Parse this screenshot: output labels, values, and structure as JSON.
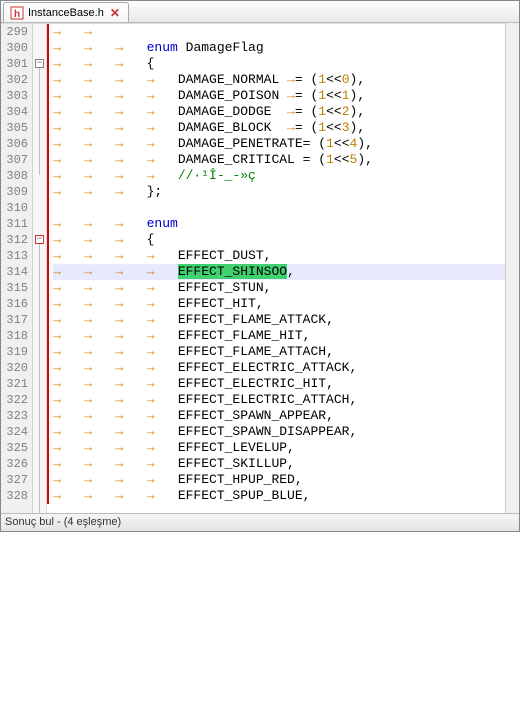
{
  "tab": {
    "filename": "InstanceBase.h"
  },
  "status_text": "Sonuç bul - (4 eşleşme)",
  "first_line_no": 299,
  "fold_boxes": [
    {
      "line": 301,
      "sym": "−"
    },
    {
      "line": 312,
      "sym": "−",
      "red": true
    }
  ],
  "highlighted_line": 314,
  "lines": [
    {
      "n": 299,
      "seg": [
        {
          "t": "→   →   ",
          "c": "arr"
        }
      ]
    },
    {
      "n": 300,
      "seg": [
        {
          "t": "→   →   →   ",
          "c": "arr"
        },
        {
          "t": "enum",
          "c": "kw"
        },
        {
          "t": " DamageFlag"
        }
      ]
    },
    {
      "n": 301,
      "seg": [
        {
          "t": "→   →   →   ",
          "c": "arr"
        },
        {
          "t": "{",
          "c": "op"
        }
      ]
    },
    {
      "n": 302,
      "seg": [
        {
          "t": "→   →   →   →   ",
          "c": "arr"
        },
        {
          "t": "DAMAGE_NORMAL "
        },
        {
          "t": "→",
          "c": "arr"
        },
        {
          "t": "= ",
          "c": "op"
        },
        {
          "t": "(",
          "c": "op"
        },
        {
          "t": "1",
          "c": "num"
        },
        {
          "t": "<<",
          "c": "op"
        },
        {
          "t": "0",
          "c": "num"
        },
        {
          "t": "),",
          "c": "op"
        }
      ]
    },
    {
      "n": 303,
      "seg": [
        {
          "t": "→   →   →   →   ",
          "c": "arr"
        },
        {
          "t": "DAMAGE_POISON "
        },
        {
          "t": "→",
          "c": "arr"
        },
        {
          "t": "= ",
          "c": "op"
        },
        {
          "t": "(",
          "c": "op"
        },
        {
          "t": "1",
          "c": "num"
        },
        {
          "t": "<<",
          "c": "op"
        },
        {
          "t": "1",
          "c": "num"
        },
        {
          "t": "),",
          "c": "op"
        }
      ]
    },
    {
      "n": 304,
      "seg": [
        {
          "t": "→   →   →   →   ",
          "c": "arr"
        },
        {
          "t": "DAMAGE_DODGE  "
        },
        {
          "t": "→",
          "c": "arr"
        },
        {
          "t": "= ",
          "c": "op"
        },
        {
          "t": "(",
          "c": "op"
        },
        {
          "t": "1",
          "c": "num"
        },
        {
          "t": "<<",
          "c": "op"
        },
        {
          "t": "2",
          "c": "num"
        },
        {
          "t": "),",
          "c": "op"
        }
      ]
    },
    {
      "n": 305,
      "seg": [
        {
          "t": "→   →   →   →   ",
          "c": "arr"
        },
        {
          "t": "DAMAGE_BLOCK  "
        },
        {
          "t": "→",
          "c": "arr"
        },
        {
          "t": "= ",
          "c": "op"
        },
        {
          "t": "(",
          "c": "op"
        },
        {
          "t": "1",
          "c": "num"
        },
        {
          "t": "<<",
          "c": "op"
        },
        {
          "t": "3",
          "c": "num"
        },
        {
          "t": "),",
          "c": "op"
        }
      ]
    },
    {
      "n": 306,
      "seg": [
        {
          "t": "→   →   →   →   ",
          "c": "arr"
        },
        {
          "t": "DAMAGE_PENETRATE"
        },
        {
          "t": "= ",
          "c": "op"
        },
        {
          "t": "(",
          "c": "op"
        },
        {
          "t": "1",
          "c": "num"
        },
        {
          "t": "<<",
          "c": "op"
        },
        {
          "t": "4",
          "c": "num"
        },
        {
          "t": "),",
          "c": "op"
        }
      ]
    },
    {
      "n": 307,
      "seg": [
        {
          "t": "→   →   →   →   ",
          "c": "arr"
        },
        {
          "t": "DAMAGE_CRITICAL "
        },
        {
          "t": "= ",
          "c": "op"
        },
        {
          "t": "(",
          "c": "op"
        },
        {
          "t": "1",
          "c": "num"
        },
        {
          "t": "<<",
          "c": "op"
        },
        {
          "t": "5",
          "c": "num"
        },
        {
          "t": "),",
          "c": "op"
        }
      ]
    },
    {
      "n": 308,
      "seg": [
        {
          "t": "→   →   →   →   ",
          "c": "arr"
        },
        {
          "t": "//·¹Î-_-»ç",
          "c": "cm"
        }
      ]
    },
    {
      "n": 309,
      "seg": [
        {
          "t": "→   →   →   ",
          "c": "arr"
        },
        {
          "t": "};",
          "c": "op"
        }
      ]
    },
    {
      "n": 310,
      "seg": []
    },
    {
      "n": 311,
      "seg": [
        {
          "t": "→   →   →   ",
          "c": "arr"
        },
        {
          "t": "enum",
          "c": "kw"
        }
      ]
    },
    {
      "n": 312,
      "seg": [
        {
          "t": "→   →   →   ",
          "c": "arr"
        },
        {
          "t": "{",
          "c": "op"
        }
      ]
    },
    {
      "n": 313,
      "seg": [
        {
          "t": "→   →   →   →   ",
          "c": "arr"
        },
        {
          "t": "EFFECT_DUST"
        },
        {
          "t": ",",
          "c": "op"
        }
      ]
    },
    {
      "n": 314,
      "seg": [
        {
          "t": "→   →   →   →   ",
          "c": "arr"
        },
        {
          "t": "EFFECT_SHINSOO",
          "c": "selbg"
        },
        {
          "t": ",",
          "c": "op"
        }
      ]
    },
    {
      "n": 315,
      "seg": [
        {
          "t": "→   →   →   →   ",
          "c": "arr"
        },
        {
          "t": "EFFECT_STUN"
        },
        {
          "t": ",",
          "c": "op"
        }
      ]
    },
    {
      "n": 316,
      "seg": [
        {
          "t": "→   →   →   →   ",
          "c": "arr"
        },
        {
          "t": "EFFECT_HIT"
        },
        {
          "t": ",",
          "c": "op"
        }
      ]
    },
    {
      "n": 317,
      "seg": [
        {
          "t": "→   →   →   →   ",
          "c": "arr"
        },
        {
          "t": "EFFECT_FLAME_ATTACK"
        },
        {
          "t": ",",
          "c": "op"
        }
      ]
    },
    {
      "n": 318,
      "seg": [
        {
          "t": "→   →   →   →   ",
          "c": "arr"
        },
        {
          "t": "EFFECT_FLAME_HIT"
        },
        {
          "t": ",",
          "c": "op"
        }
      ]
    },
    {
      "n": 319,
      "seg": [
        {
          "t": "→   →   →   →   ",
          "c": "arr"
        },
        {
          "t": "EFFECT_FLAME_ATTACH"
        },
        {
          "t": ",",
          "c": "op"
        }
      ]
    },
    {
      "n": 320,
      "seg": [
        {
          "t": "→   →   →   →   ",
          "c": "arr"
        },
        {
          "t": "EFFECT_ELECTRIC_ATTACK"
        },
        {
          "t": ",",
          "c": "op"
        }
      ]
    },
    {
      "n": 321,
      "seg": [
        {
          "t": "→   →   →   →   ",
          "c": "arr"
        },
        {
          "t": "EFFECT_ELECTRIC_HIT"
        },
        {
          "t": ",",
          "c": "op"
        }
      ]
    },
    {
      "n": 322,
      "seg": [
        {
          "t": "→   →   →   →   ",
          "c": "arr"
        },
        {
          "t": "EFFECT_ELECTRIC_ATTACH"
        },
        {
          "t": ",",
          "c": "op"
        }
      ]
    },
    {
      "n": 323,
      "seg": [
        {
          "t": "→   →   →   →   ",
          "c": "arr"
        },
        {
          "t": "EFFECT_SPAWN_APPEAR"
        },
        {
          "t": ",",
          "c": "op"
        }
      ]
    },
    {
      "n": 324,
      "seg": [
        {
          "t": "→   →   →   →   ",
          "c": "arr"
        },
        {
          "t": "EFFECT_SPAWN_DISAPPEAR"
        },
        {
          "t": ",",
          "c": "op"
        }
      ]
    },
    {
      "n": 325,
      "seg": [
        {
          "t": "→   →   →   →   ",
          "c": "arr"
        },
        {
          "t": "EFFECT_LEVELUP"
        },
        {
          "t": ",",
          "c": "op"
        }
      ]
    },
    {
      "n": 326,
      "seg": [
        {
          "t": "→   →   →   →   ",
          "c": "arr"
        },
        {
          "t": "EFFECT_SKILLUP"
        },
        {
          "t": ",",
          "c": "op"
        }
      ]
    },
    {
      "n": 327,
      "seg": [
        {
          "t": "→   →   →   →   ",
          "c": "arr"
        },
        {
          "t": "EFFECT_HPUP_RED"
        },
        {
          "t": ",",
          "c": "op"
        }
      ]
    },
    {
      "n": 328,
      "seg": [
        {
          "t": "→   →   →   →   ",
          "c": "arr"
        },
        {
          "t": "EFFECT_SPUP_BLUE"
        },
        {
          "t": ",",
          "c": "op"
        }
      ]
    }
  ]
}
